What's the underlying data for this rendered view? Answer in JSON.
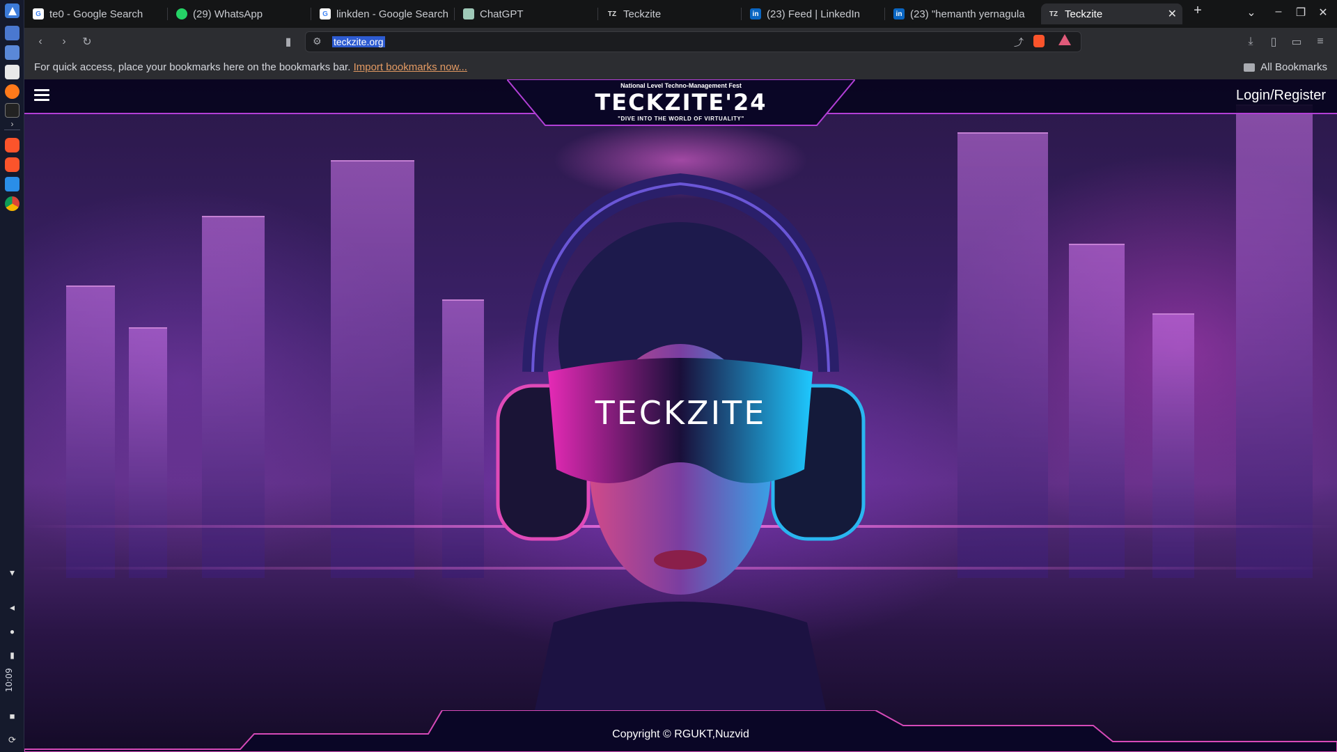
{
  "tabs": [
    {
      "title": "te0 - Google Search",
      "favicon": "google-icon"
    },
    {
      "title": "(29) WhatsApp",
      "favicon": "whatsapp-icon"
    },
    {
      "title": "linkden - Google Search",
      "favicon": "google-icon"
    },
    {
      "title": "ChatGPT",
      "favicon": "chatgpt-icon"
    },
    {
      "title": "Teckzite",
      "favicon": "teckzite-icon"
    },
    {
      "title": "(23) Feed | LinkedIn",
      "favicon": "linkedin-icon"
    },
    {
      "title": "(23) \"hemanth yernagula",
      "favicon": "linkedin-icon"
    },
    {
      "title": "Teckzite",
      "favicon": "teckzite-icon",
      "active": true
    }
  ],
  "address_bar": {
    "url": "teckzite.org"
  },
  "bookmarks_bar": {
    "hint": "For quick access, place your bookmarks here on the bookmarks bar.",
    "import_link": "Import bookmarks now...",
    "all_bookmarks": "All Bookmarks"
  },
  "os_dock": {
    "clock": "10:09"
  },
  "site": {
    "logo_kicker": "National Level Techno-Management Fest",
    "logo_title": "TECKZITE'24",
    "logo_tagline": "\"DIVE INTO THE WORLD OF VIRTUALITY\"",
    "login_label": "Login/Register",
    "visor_text": "TECKZITE",
    "copyright": "Copyright © RGUKT,Nuzvid"
  },
  "colors": {
    "accent_magenta": "#b23fd6",
    "neon_pink": "#ff6fe6",
    "url_highlight": "#2d5bd1",
    "import_link": "#e39a63"
  }
}
